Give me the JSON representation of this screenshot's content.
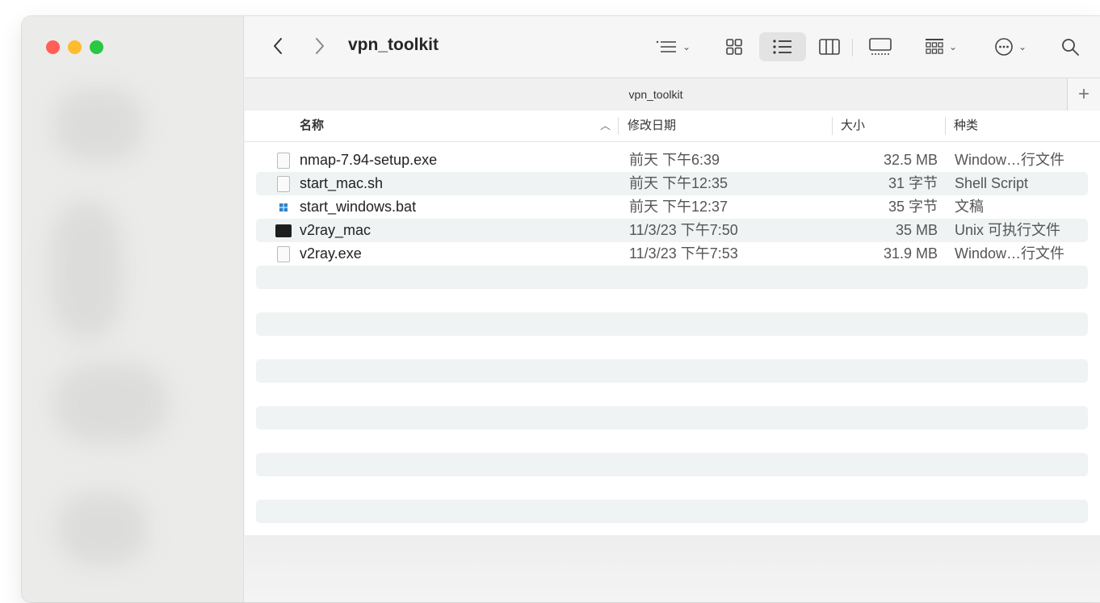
{
  "window": {
    "title": "vpn_toolkit"
  },
  "tab": {
    "title": "vpn_toolkit",
    "add_label": "+"
  },
  "toolbar": {
    "back_icon": "chevron-left-icon",
    "forward_icon": "chevron-right-icon",
    "view_mode": "list"
  },
  "columns": {
    "name": "名称",
    "date": "修改日期",
    "size": "大小",
    "kind": "种类"
  },
  "files": [
    {
      "name": "nmap-7.94-setup.exe",
      "date": "前天 下午6:39",
      "size": "32.5 MB",
      "kind": "Window…行文件",
      "icon": "exe-file-icon"
    },
    {
      "name": "start_mac.sh",
      "date": "前天 下午12:35",
      "size": "31 字节",
      "kind": "Shell Script",
      "icon": "shell-script-icon"
    },
    {
      "name": "start_windows.bat",
      "date": "前天 下午12:37",
      "size": "35 字节",
      "kind": "文稿",
      "icon": "bat-file-icon"
    },
    {
      "name": "v2ray_mac",
      "date": "11/3/23 下午7:50",
      "size": "35 MB",
      "kind": "Unix 可执行文件",
      "icon": "terminal-executable-icon"
    },
    {
      "name": "v2ray.exe",
      "date": "11/3/23 下午7:53",
      "size": "31.9 MB",
      "kind": "Window…行文件",
      "icon": "exe-file-icon"
    }
  ],
  "colors": {
    "close": "#ff5f57",
    "minimize": "#febc2e",
    "maximize": "#28c840",
    "stripe": "#f0f3f3"
  }
}
